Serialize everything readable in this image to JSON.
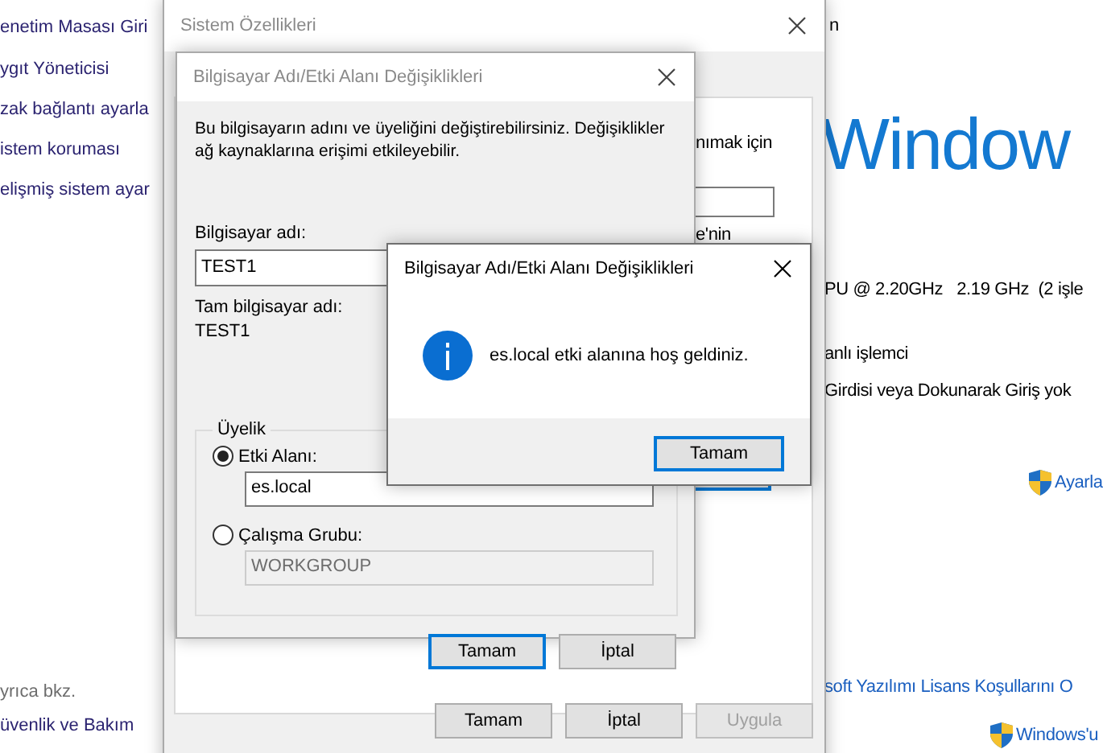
{
  "control_panel": {
    "sidebar_links": [
      "enetim Masası Giri",
      "ygıt Yöneticisi",
      "zak bağlantı ayarla",
      "istem koruması",
      "elişmiş sistem ayar"
    ],
    "see_also_heading": "yrıca bkz.",
    "see_also_links": [
      "üvenlik ve Bakım"
    ],
    "header_fragment": "n",
    "windows_wordmark": "Window",
    "processor": "PU @ 2.20GHz   2.19 GHz  (2 işle",
    "system_type": "anlı işlemci",
    "pen_touch": "Girdisi veya Dokunarak Giriş yok",
    "change_settings_link": "Ayarla",
    "license_link": "soft Yazılımı Lisans Koşullarını O",
    "activate_link": "Windows'u"
  },
  "system_properties": {
    "title": "Sistem Özellikleri",
    "active": false,
    "panel_texts": [
      "nımak için",
      "e'nin"
    ],
    "buttons": [
      {
        "label": "Tamam",
        "disabled": false
      },
      {
        "label": "İptal",
        "disabled": false
      },
      {
        "label": "Uygula",
        "disabled": true
      }
    ]
  },
  "name_dialog": {
    "title": "Bilgisayar Adı/Etki Alanı Değişiklikleri",
    "active": false,
    "description": "Bu bilgisayarın adını ve üyeliğini değiştirebilirsiniz. Değişiklikler ağ kaynaklarına erişimi etkileyebilir.",
    "computer_name_label": "Bilgisayar adı:",
    "computer_name": "TEST1",
    "full_name_label": "Tam bilgisayar adı:",
    "full_name": "TEST1",
    "membership": {
      "legend": "Üyelik",
      "options": [
        {
          "label": "Etki Alanı:",
          "selected": true,
          "value": "es.local"
        },
        {
          "label": "Çalışma Grubu:",
          "selected": false,
          "value": "WORKGROUP"
        }
      ]
    },
    "buttons": [
      {
        "label": "Tamam",
        "default": true
      },
      {
        "label": "İptal",
        "default": false
      }
    ]
  },
  "message_box": {
    "title": "Bilgisayar Adı/Etki Alanı Değişiklikleri",
    "active": true,
    "message": "es.local etki alanına hoş geldiniz.",
    "buttons": [
      {
        "label": "Tamam",
        "default": true
      }
    ]
  }
}
